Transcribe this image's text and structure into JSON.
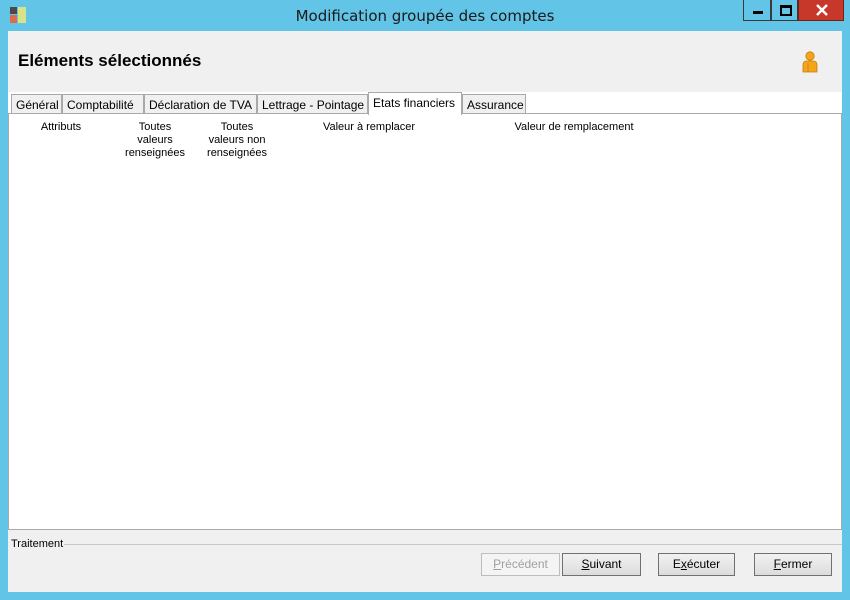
{
  "window": {
    "title": "Modification groupée des comptes"
  },
  "header": {
    "title": "Eléments sélectionnés",
    "user_icon": "user-icon"
  },
  "tabs": [
    {
      "label": "Général"
    },
    {
      "label": "Comptabilité"
    },
    {
      "label": "Déclaration de TVA"
    },
    {
      "label": "Lettrage - Pointage"
    },
    {
      "label": "Etats financiers",
      "active": true
    },
    {
      "label": "Assurance"
    }
  ],
  "table": {
    "columns": {
      "attributs": "Attributs",
      "all_filled": [
        "Toutes",
        "valeurs",
        "renseignées"
      ],
      "all_empty": [
        "Toutes",
        "valeurs non",
        "renseignées"
      ],
      "value_to_replace": "Valeur à remplacer",
      "replacement_value": "Valeur de remplacement"
    }
  },
  "treatment": {
    "legend": "Traitement"
  },
  "buttons": {
    "previous": {
      "first": "P",
      "rest": "récédent",
      "enabled": false
    },
    "next": {
      "first": "S",
      "rest": "uivant"
    },
    "execute": {
      "pre": "E",
      "first": "x",
      "rest": "écuter"
    },
    "close": {
      "first": "F",
      "rest": "ermer"
    }
  },
  "colors": {
    "frame": "#62c4e6",
    "close_button": "#c7382b",
    "client_bg": "#f0f0f0"
  }
}
